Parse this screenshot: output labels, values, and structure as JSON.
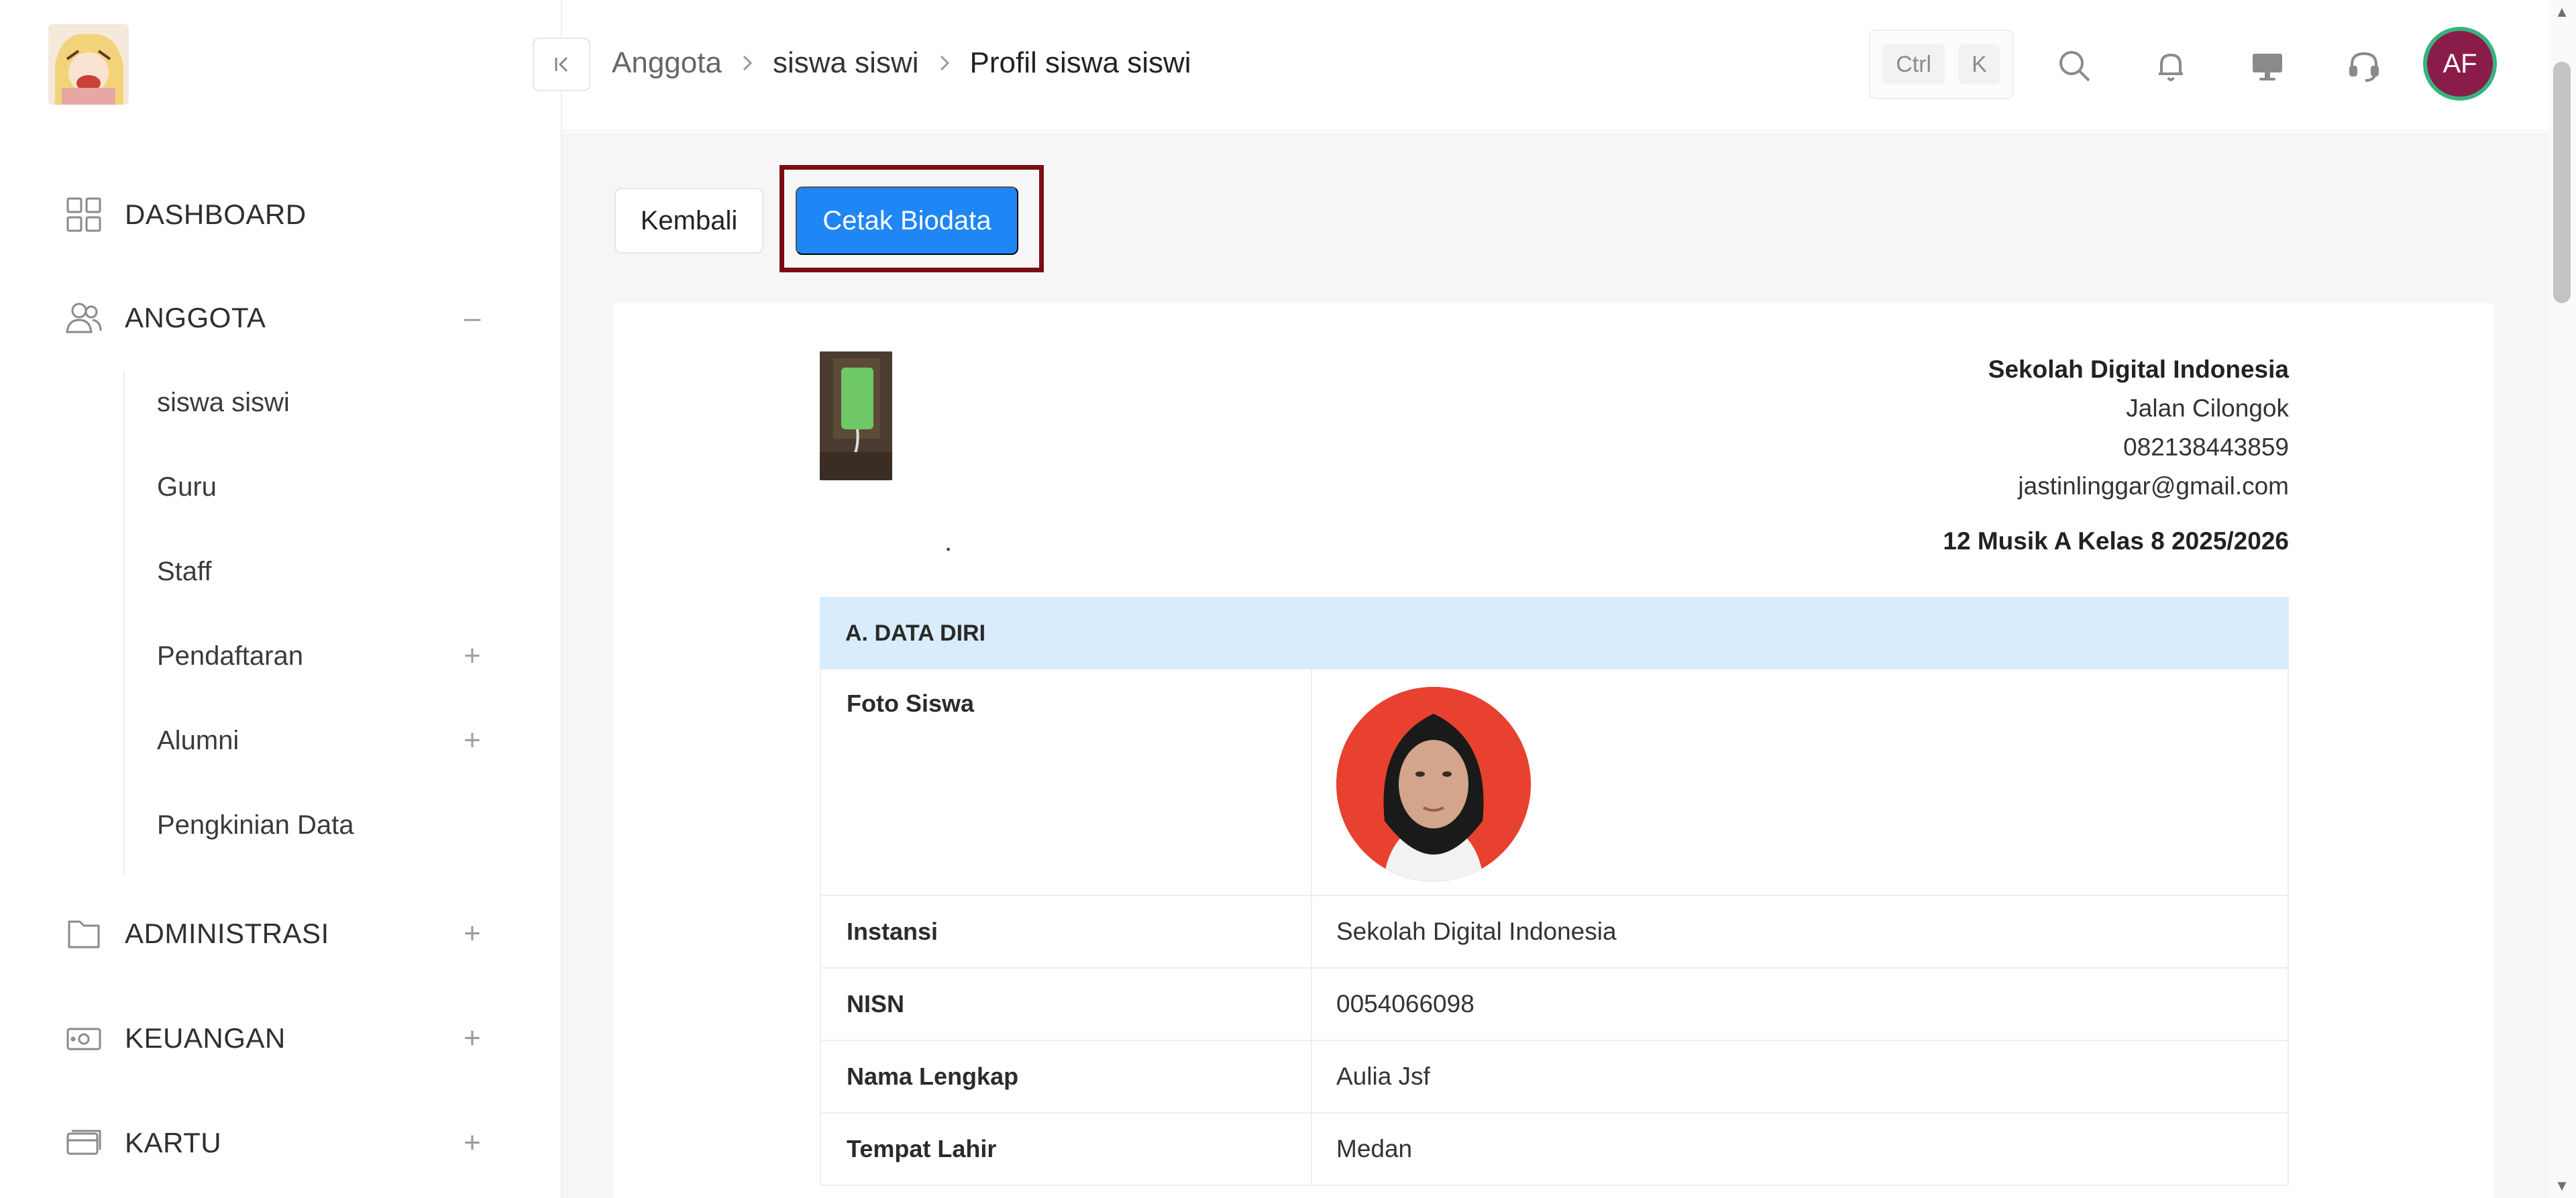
{
  "breadcrumb": [
    "Anggota",
    "siswa siswi",
    "Profil siswa siswi"
  ],
  "shortcut": {
    "ctrl": "Ctrl",
    "key": "K"
  },
  "user": {
    "initials": "AF"
  },
  "sidebar": {
    "groups": [
      {
        "label": "DASHBOARD",
        "icon": "dashboard-icon",
        "toggle": ""
      },
      {
        "label": "ANGGOTA",
        "icon": "users-icon",
        "toggle": "–"
      },
      {
        "label": "ADMINISTRASI",
        "icon": "folder-icon",
        "toggle": "+"
      },
      {
        "label": "KEUANGAN",
        "icon": "money-icon",
        "toggle": "+"
      },
      {
        "label": "KARTU",
        "icon": "card-icon",
        "toggle": "+"
      }
    ],
    "sub_items": [
      {
        "label": "siswa siswi",
        "toggle": ""
      },
      {
        "label": "Guru",
        "toggle": ""
      },
      {
        "label": "Staff",
        "toggle": ""
      },
      {
        "label": "Pendaftaran",
        "toggle": "+"
      },
      {
        "label": "Alumni",
        "toggle": "+"
      },
      {
        "label": "Pengkinian Data",
        "toggle": ""
      }
    ]
  },
  "actions": {
    "back_label": "Kembali",
    "print_label": "Cetak Biodata"
  },
  "school": {
    "name": "Sekolah Digital Indonesia",
    "address": "Jalan Cilongok",
    "phone": "082138443859",
    "email": "jastinlinggar@gmail.com",
    "class_info": "12 Musik A Kelas 8 2025/2026",
    "dot": "."
  },
  "profile": {
    "section_title": "A. DATA DIRI",
    "photo_label": "Foto Siswa",
    "rows": [
      {
        "key": "Instansi",
        "value": "Sekolah Digital Indonesia"
      },
      {
        "key": "NISN",
        "value": "0054066098"
      },
      {
        "key": "Nama Lengkap",
        "value": "Aulia Jsf"
      },
      {
        "key": "Tempat Lahir",
        "value": "Medan"
      }
    ]
  },
  "colors": {
    "primary": "#1f86f5",
    "highlight": "#7a0d14",
    "avatar_bg": "#8a1c4a",
    "avatar_ring": "#37b37e",
    "section_bg": "#d9ecfb"
  }
}
